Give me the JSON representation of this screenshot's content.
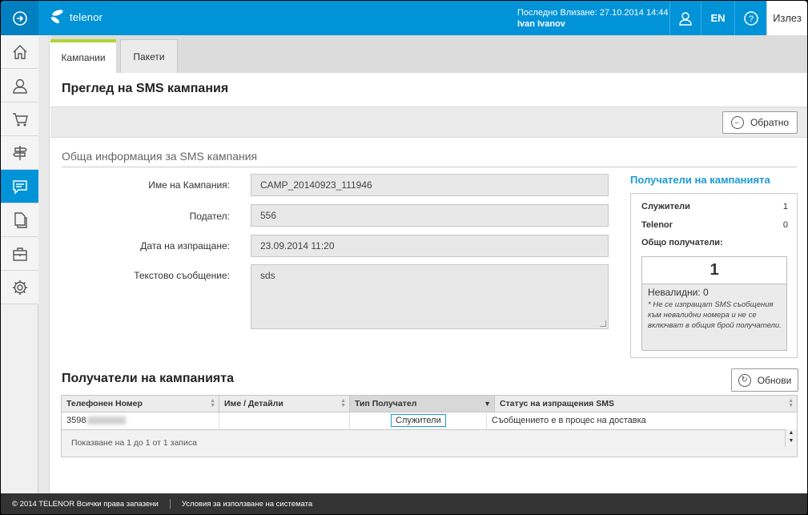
{
  "brand": {
    "logo_text": "telenor"
  },
  "header": {
    "last_login_label": "Последно Влизане: 27.10.2014 14:44",
    "user_name": "Ivan Ivanov",
    "lang": "EN",
    "logout": "Излез"
  },
  "sidebar": {
    "items": [
      {
        "icon": "home-icon"
      },
      {
        "icon": "user-icon"
      },
      {
        "icon": "cart-icon"
      },
      {
        "icon": "signpost-icon"
      },
      {
        "icon": "message-icon",
        "active": true
      },
      {
        "icon": "documents-icon"
      },
      {
        "icon": "briefcase-icon"
      },
      {
        "icon": "gear-icon"
      }
    ]
  },
  "tabs": {
    "campaigns": "Кампании",
    "packages": "Пакети"
  },
  "page": {
    "title": "Преглед на SMS кампания",
    "back_button": "Обратно"
  },
  "general": {
    "section_title": "Обща информация за SMS кампания",
    "campaign_name_label": "Име на Кампания:",
    "campaign_name": "CAMP_20140923_111946",
    "sender_label": "Подател:",
    "sender": "556",
    "send_date_label": "Дата на изпращане:",
    "send_date": "23.09.2014 11:20",
    "message_label": "Текстово съобщение:",
    "message": "sds"
  },
  "recipients_summary": {
    "title": "Получатели на кампанията",
    "employees_label": "Служители",
    "employees_count": "1",
    "telenor_label": "Telenor",
    "telenor_count": "0",
    "total_label": "Общо получатели:",
    "total": "1",
    "invalid": "Невалидни: 0",
    "note": "* Не се изпращат SMS съобщения към невалидни номера и не се включват в общия брой получатели."
  },
  "recipients_table": {
    "title": "Получатели на кампанията",
    "refresh_button": "Обнови",
    "columns": [
      "Телефонен Номер",
      "Име / Детайли",
      "Тип Получател",
      "Статус на изпращения SMS"
    ],
    "rows": [
      {
        "phone": "3598",
        "name": "",
        "type": "Служители",
        "status": "Съобщението е в процес на доставка"
      }
    ],
    "footer": "Показване на 1 до 1 от 1 записа"
  },
  "footer": {
    "copyright": "© 2014 TELENOR Всички права запазени",
    "terms": "Условия за използване на системата"
  }
}
